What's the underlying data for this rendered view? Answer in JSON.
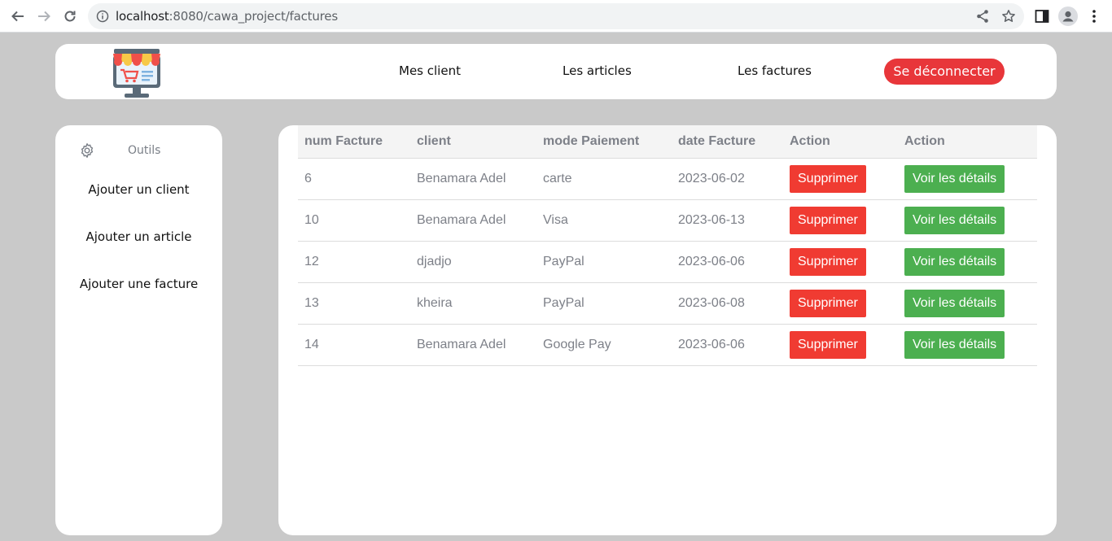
{
  "browser": {
    "url_host": "localhost",
    "url_path": ":8080/cawa_project/factures"
  },
  "nav": {
    "links": [
      "Mes client",
      "Les articles",
      "Les factures"
    ],
    "logout_label": "Se déconnecter",
    "logout_color": "#e8363a"
  },
  "sidebar": {
    "tools_label": "Outils",
    "items": [
      "Ajouter un client",
      "Ajouter un article",
      "Ajouter une facture"
    ]
  },
  "table": {
    "headers": [
      "num Facture",
      "client",
      "mode Paiement",
      "date Facture",
      "Action",
      "Action"
    ],
    "delete_label": "Supprimer",
    "details_label": "Voir les détails",
    "delete_color": "#f03b32",
    "details_color": "#4caf50",
    "rows": [
      {
        "num": "6",
        "client": "Benamara Adel",
        "mode": "carte",
        "date": "2023-06-02"
      },
      {
        "num": "10",
        "client": "Benamara Adel",
        "mode": "Visa",
        "date": "2023-06-13"
      },
      {
        "num": "12",
        "client": "djadjo",
        "mode": "PayPal",
        "date": "2023-06-06"
      },
      {
        "num": "13",
        "client": "kheira",
        "mode": "PayPal",
        "date": "2023-06-08"
      },
      {
        "num": "14",
        "client": "Benamara Adel",
        "mode": "Google Pay",
        "date": "2023-06-06"
      }
    ]
  }
}
